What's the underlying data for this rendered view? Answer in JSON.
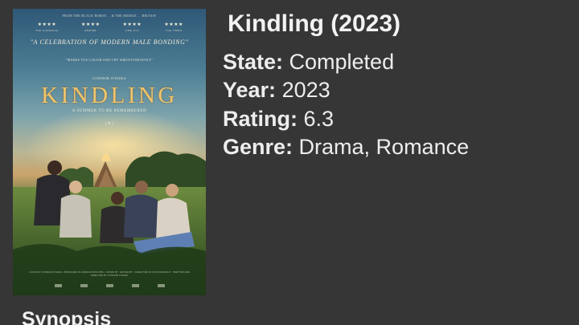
{
  "poster": {
    "top_credit": "FROM THE BLACK HORSE ... & THE BRIDGE ... BRITAIN",
    "star_ratings": [
      {
        "stars": "★★★★",
        "source": "THE GUARDIAN"
      },
      {
        "stars": "★★★★",
        "source": "EMPIRE"
      },
      {
        "stars": "★★★★",
        "source": "TIME OUT"
      },
      {
        "stars": "★★★★",
        "source": "THE TIMES"
      }
    ],
    "quote_main": "\"A CELEBRATION OF MODERN MALE BONDING\"",
    "quote_secondary": "\"MAKES YOU LAUGH AND CRY SIMULTANEOUSLY\"",
    "director_credit": "CONNOR O'HARA",
    "title": "KINDLING",
    "tagline": "A SUMMER TO BE REMEMBERED",
    "laurel": "( ★ )",
    "billing_block": "A FILM BY CONNOR O'HARA · PRODUCED IN ASSOCIATION WITH · MUSIC BY · EDITED BY · DIRECTOR OF PHOTOGRAPHY · WRITTEN AND DIRECTED BY CONNOR O'HARA"
  },
  "details": {
    "title": "Kindling (2023)",
    "state_label": "State:",
    "state_value": " Completed",
    "year_label": "Year:",
    "year_value": " 2023",
    "rating_label": "Rating:",
    "rating_value": " 6.3",
    "genre_label": "Genre:",
    "genre_value": " Drama, Romance"
  },
  "synopsis": {
    "heading": "Synopsis"
  }
}
